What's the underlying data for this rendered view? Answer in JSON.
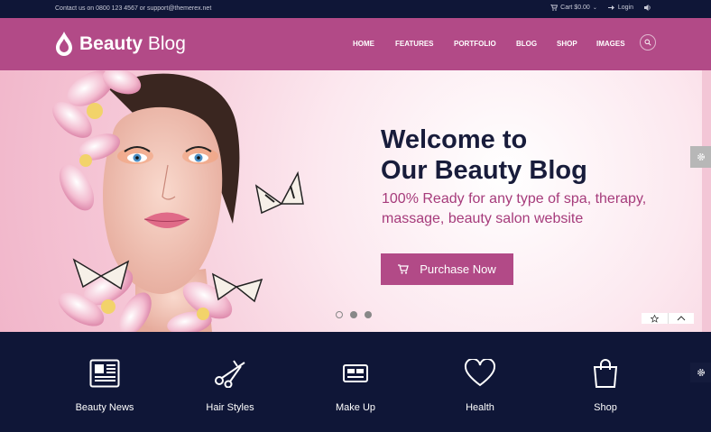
{
  "topbar": {
    "contact": "Contact us on 0800 123 4567 or support@themerex.net",
    "cart": "Cart $0.00",
    "login": "Login"
  },
  "header": {
    "brand_bold": "Beauty",
    "brand_light": "Blog",
    "nav": [
      "HOME",
      "FEATURES",
      "PORTFOLIO",
      "BLOG",
      "SHOP",
      "IMAGES"
    ]
  },
  "hero": {
    "title_line1": "Welcome to",
    "title_line2": "Our Beauty Blog",
    "subtitle_line1": "100% Ready for any type of spa, therapy,",
    "subtitle_line2": "massage, beauty salon website",
    "cta": "Purchase Now",
    "slides_total": 3,
    "slide_active": 1
  },
  "features": [
    "Beauty News",
    "Hair Styles",
    "Make Up",
    "Health",
    "Shop"
  ],
  "colors": {
    "brand": "#b24a87",
    "dark": "#0f1637",
    "heading": "#181c3b"
  },
  "icons": [
    "cart-icon",
    "login-icon",
    "sound-icon",
    "search-icon",
    "gear-icon",
    "star-icon",
    "chevron-up-icon",
    "newspaper-icon",
    "scissors-icon",
    "makeup-icon",
    "heart-icon",
    "bag-icon"
  ]
}
